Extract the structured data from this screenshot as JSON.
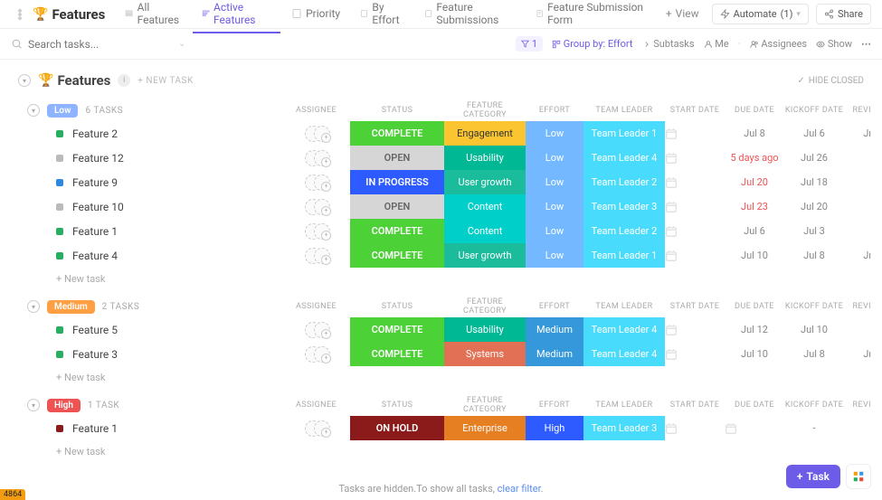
{
  "header": {
    "title": "Features",
    "tabs": [
      {
        "label": "All Features"
      },
      {
        "label": "Active Features",
        "active": true
      },
      {
        "label": "Priority"
      },
      {
        "label": "By Effort"
      },
      {
        "label": "Feature Submissions"
      },
      {
        "label": "Feature Submission Form"
      }
    ],
    "view_btn": "View",
    "automate_btn": "Automate",
    "automate_count": "(1)",
    "share_btn": "Share"
  },
  "filterbar": {
    "search_placeholder": "Search tasks...",
    "filter_count": "1",
    "group_label": "Group by:",
    "group_value": "Effort",
    "subtasks": "Subtasks",
    "me": "Me",
    "assignees": "Assignees",
    "show": "Show"
  },
  "main": {
    "title": "Features",
    "new_task": "+ NEW TASK",
    "hide_closed": "HIDE CLOSED"
  },
  "columns": {
    "assignee": "ASSIGNEE",
    "status": "STATUS",
    "category": "FEATURE CATEGORY",
    "effort": "EFFORT",
    "leader": "TEAM LEADER",
    "start": "START DATE",
    "due": "DUE DATE",
    "kickoff": "KICKOFF DATE",
    "review": "REVI"
  },
  "groups": [
    {
      "name": "Low",
      "pill_class": "low",
      "count": "6 TASKS",
      "rows": [
        {
          "sq": "green",
          "name": "Feature 2",
          "status": "COMPLETE",
          "status_c": "c-complete",
          "cat": "Engagement",
          "cat_c": "c-engage",
          "eff": "Low",
          "eff_c": "c-effort-low",
          "lead": "Team Leader 1",
          "start": "",
          "due": "Jul 8",
          "kick": "Jul 6",
          "rev": "Jı"
        },
        {
          "sq": "grey",
          "name": "Feature 12",
          "status": "OPEN",
          "status_c": "c-open",
          "cat": "Usability",
          "cat_c": "c-usability",
          "eff": "Low",
          "eff_c": "c-effort-low",
          "lead": "Team Leader 4",
          "start": "",
          "due": "5 days ago",
          "due_red": true,
          "kick": "Jul 26",
          "rev": ""
        },
        {
          "sq": "blue",
          "name": "Feature 9",
          "status": "IN PROGRESS",
          "status_c": "c-progress",
          "cat": "User growth",
          "cat_c": "c-usergrowth",
          "eff": "Low",
          "eff_c": "c-effort-low",
          "lead": "Team Leader 2",
          "start": "",
          "due": "Jul 20",
          "due_red": true,
          "kick": "Jul 18",
          "rev": ""
        },
        {
          "sq": "grey",
          "name": "Feature 10",
          "status": "OPEN",
          "status_c": "c-open",
          "cat": "Content",
          "cat_c": "c-content",
          "eff": "Low",
          "eff_c": "c-effort-low",
          "lead": "Team Leader 3",
          "start": "",
          "due": "Jul 23",
          "due_red": true,
          "kick": "Jul 20",
          "rev": ""
        },
        {
          "sq": "green",
          "name": "Feature 1",
          "status": "COMPLETE",
          "status_c": "c-complete",
          "cat": "Content",
          "cat_c": "c-content",
          "eff": "Low",
          "eff_c": "c-effort-low",
          "lead": "Team Leader 2",
          "start": "",
          "due": "Jul 6",
          "kick": "Jul 3",
          "rev": ""
        },
        {
          "sq": "green",
          "name": "Feature 4",
          "status": "COMPLETE",
          "status_c": "c-complete",
          "cat": "User growth",
          "cat_c": "c-usergrowth",
          "eff": "Low",
          "eff_c": "c-effort-low",
          "lead": "Team Leader 1",
          "start": "",
          "due": "Jul 10",
          "kick": "Jul 8",
          "rev": "Jı"
        }
      ]
    },
    {
      "name": "Medium",
      "pill_class": "med",
      "count": "2 TASKS",
      "rows": [
        {
          "sq": "green",
          "name": "Feature 5",
          "status": "COMPLETE",
          "status_c": "c-complete",
          "cat": "Usability",
          "cat_c": "c-usability",
          "eff": "Medium",
          "eff_c": "c-effort-med",
          "lead": "Team Leader 4",
          "start": "",
          "due": "Jul 12",
          "kick": "Jul 10",
          "rev": ""
        },
        {
          "sq": "green",
          "name": "Feature 3",
          "status": "COMPLETE",
          "status_c": "c-complete",
          "cat": "Systems",
          "cat_c": "c-systems",
          "eff": "Medium",
          "eff_c": "c-effort-med",
          "lead": "Team Leader 4",
          "start": "",
          "due": "Jul 10",
          "kick": "Jul 8",
          "rev": "Jı"
        }
      ]
    },
    {
      "name": "High",
      "pill_class": "high",
      "count": "1 TASK",
      "rows": [
        {
          "sq": "darkred",
          "name": "Feature 1",
          "status": "ON HOLD",
          "status_c": "c-hold",
          "cat": "Enterprise",
          "cat_c": "c-enterprise",
          "eff": "High",
          "eff_c": "c-effort-high",
          "lead": "Team Leader 3",
          "start": "",
          "due": "",
          "kick": "-",
          "rev": ""
        }
      ]
    }
  ],
  "new_task_row": "+ New task",
  "footer": {
    "msg": "Tasks are hidden.To show all tasks, ",
    "link": "clear filter",
    "dot": "."
  },
  "fab": {
    "task": "Task"
  },
  "corner": "4864"
}
